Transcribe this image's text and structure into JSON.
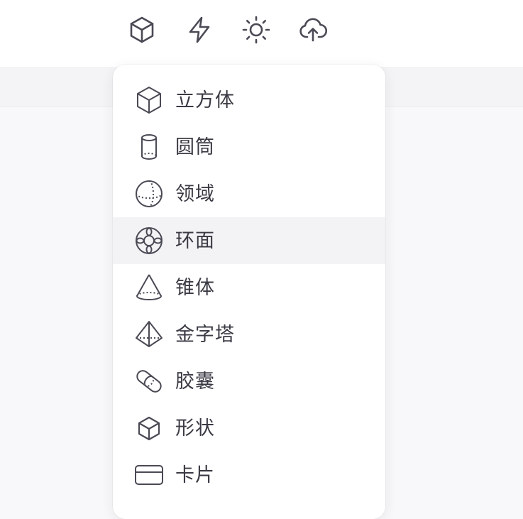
{
  "toolbar": {
    "buttons": [
      {
        "icon": "cube-icon"
      },
      {
        "icon": "lightning-icon"
      },
      {
        "icon": "sun-icon"
      },
      {
        "icon": "cloud-upload-icon"
      }
    ]
  },
  "menu": {
    "items": [
      {
        "label": "立方体",
        "icon": "cube-icon"
      },
      {
        "label": "圆筒",
        "icon": "cylinder-icon"
      },
      {
        "label": "领域",
        "icon": "sphere-icon"
      },
      {
        "label": "环面",
        "icon": "torus-icon",
        "highlighted": true
      },
      {
        "label": "锥体",
        "icon": "cone-icon"
      },
      {
        "label": "金字塔",
        "icon": "pyramid-icon"
      },
      {
        "label": "胶囊",
        "icon": "capsule-icon"
      },
      {
        "label": "形状",
        "icon": "shape-icon"
      },
      {
        "label": "卡片",
        "icon": "card-icon"
      }
    ]
  },
  "colors": {
    "icon_stroke": "#4a4a55",
    "label_text": "#3a3a44",
    "highlight_bg": "#f3f3f6"
  }
}
